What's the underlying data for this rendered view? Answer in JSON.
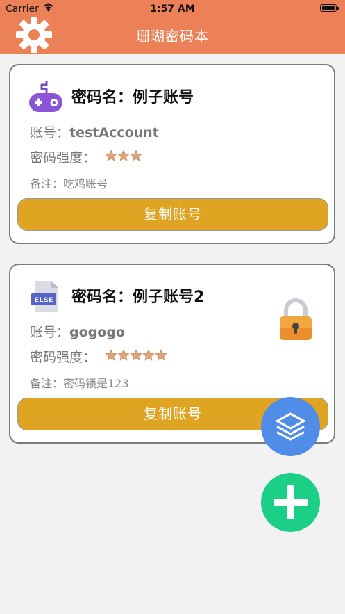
{
  "status_bar": {
    "carrier": "Carrier",
    "time": "1:57 AM"
  },
  "header": {
    "title": "珊瑚密码本",
    "settings_icon": "gear-icon"
  },
  "cards": [
    {
      "icon": "gamepad-icon",
      "name": "密码名：例子账号",
      "account_label": "账号：",
      "account_value": "testAccount",
      "strength_label": "密码强度：",
      "strength_stars": 3,
      "note": "备注：吃鸡账号",
      "copy_button": "复制账号",
      "locked": false
    },
    {
      "icon": "else-file-icon",
      "icon_text": "ELSE",
      "name": "密码名：例子账号2",
      "account_label": "账号：",
      "account_value": "gogogo",
      "strength_label": "密码强度：",
      "strength_stars": 5,
      "note": "备注：密码锁是123",
      "copy_button": "复制账号",
      "locked": true
    }
  ],
  "fabs": [
    {
      "icon": "layers-icon",
      "color": "#4f8de8"
    },
    {
      "icon": "plus-icon",
      "color": "#1bcf87"
    }
  ],
  "colors": {
    "header": "#ec8056",
    "copy_button": "#dea422",
    "star": "#e3a47a"
  }
}
